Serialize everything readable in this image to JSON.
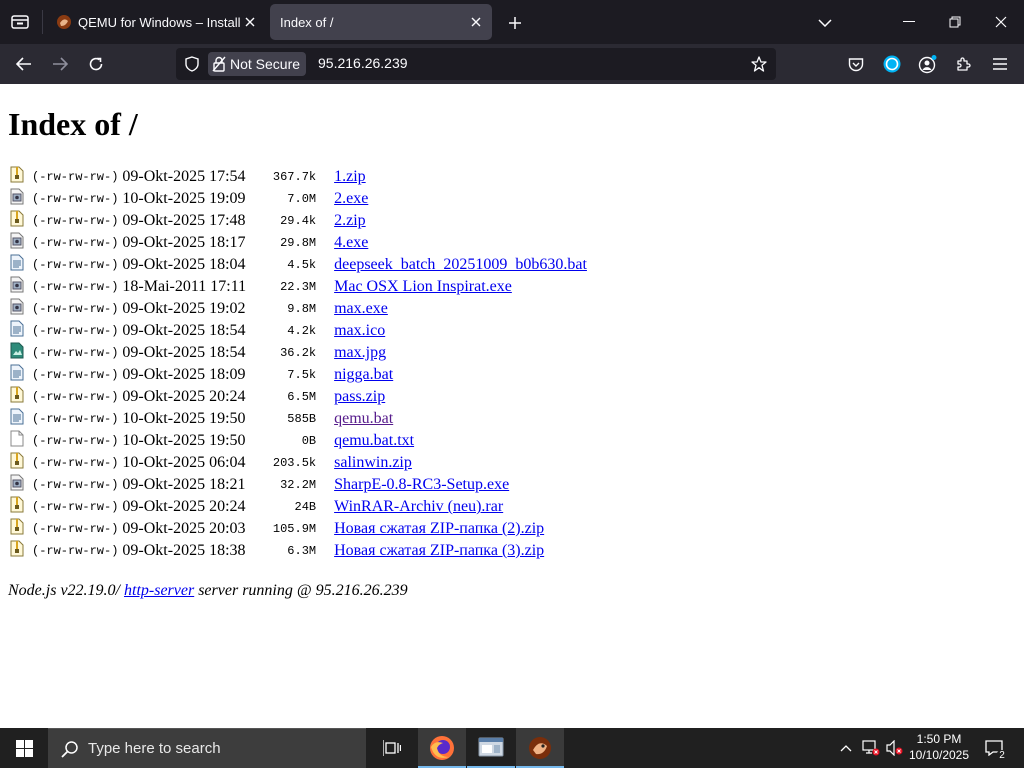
{
  "browser": {
    "tabs": [
      {
        "title": "QEMU for Windows – Installers",
        "active": false
      },
      {
        "title": "Index of /",
        "active": true
      }
    ],
    "security_label": "Not Secure",
    "url": "95.216.26.239"
  },
  "page": {
    "title": "Index of /",
    "files": [
      {
        "icon": "zip-file-icon",
        "perms": "(-rw-rw-rw-)",
        "date": "09-Okt-2025 17:54",
        "size": "367.7k",
        "name": "1.zip"
      },
      {
        "icon": "exe-file-icon",
        "perms": "(-rw-rw-rw-)",
        "date": "10-Okt-2025 19:09",
        "size": "7.0M",
        "name": "2.exe"
      },
      {
        "icon": "zip-file-icon",
        "perms": "(-rw-rw-rw-)",
        "date": "09-Okt-2025 17:48",
        "size": "29.4k",
        "name": "2.zip"
      },
      {
        "icon": "exe-file-icon",
        "perms": "(-rw-rw-rw-)",
        "date": "09-Okt-2025 18:17",
        "size": "29.8M",
        "name": "4.exe"
      },
      {
        "icon": "text-file-icon",
        "perms": "(-rw-rw-rw-)",
        "date": "09-Okt-2025 18:04",
        "size": "4.5k",
        "name": "deepseek_batch_20251009_b0b630.bat"
      },
      {
        "icon": "exe-file-icon",
        "perms": "(-rw-rw-rw-)",
        "date": "18-Mai-2011 17:11",
        "size": "22.3M",
        "name": "Mac OSX Lion Inspirat.exe"
      },
      {
        "icon": "exe-file-icon",
        "perms": "(-rw-rw-rw-)",
        "date": "09-Okt-2025 19:02",
        "size": "9.8M",
        "name": "max.exe"
      },
      {
        "icon": "text-file-icon",
        "perms": "(-rw-rw-rw-)",
        "date": "09-Okt-2025 18:54",
        "size": "4.2k",
        "name": "max.ico"
      },
      {
        "icon": "image-file-icon",
        "perms": "(-rw-rw-rw-)",
        "date": "09-Okt-2025 18:54",
        "size": "36.2k",
        "name": "max.jpg"
      },
      {
        "icon": "text-file-icon",
        "perms": "(-rw-rw-rw-)",
        "date": "09-Okt-2025 18:09",
        "size": "7.5k",
        "name": "nigga.bat"
      },
      {
        "icon": "zip-file-icon",
        "perms": "(-rw-rw-rw-)",
        "date": "09-Okt-2025 20:24",
        "size": "6.5M",
        "name": "pass.zip"
      },
      {
        "icon": "text-file-icon",
        "perms": "(-rw-rw-rw-)",
        "date": "10-Okt-2025 19:50",
        "size": "585B",
        "name": "qemu.bat",
        "visited": true
      },
      {
        "icon": "blank-file-icon",
        "perms": "(-rw-rw-rw-)",
        "date": "10-Okt-2025 19:50",
        "size": "0B",
        "name": "qemu.bat.txt"
      },
      {
        "icon": "zip-file-icon",
        "perms": "(-rw-rw-rw-)",
        "date": "10-Okt-2025 06:04",
        "size": "203.5k",
        "name": "salinwin.zip"
      },
      {
        "icon": "exe-file-icon",
        "perms": "(-rw-rw-rw-)",
        "date": "09-Okt-2025 18:21",
        "size": "32.2M",
        "name": "SharpE-0.8-RC3-Setup.exe"
      },
      {
        "icon": "zip-file-icon",
        "perms": "(-rw-rw-rw-)",
        "date": "09-Okt-2025 20:24",
        "size": "24B",
        "name": "WinRAR-Archiv (neu).rar"
      },
      {
        "icon": "zip-file-icon",
        "perms": "(-rw-rw-rw-)",
        "date": "09-Okt-2025 20:03",
        "size": "105.9M",
        "name": "Новая сжатая ZIP-папка (2).zip"
      },
      {
        "icon": "zip-file-icon",
        "perms": "(-rw-rw-rw-)",
        "date": "09-Okt-2025 18:38",
        "size": "6.3M",
        "name": "Новая сжатая ZIP-папка (3).zip"
      }
    ],
    "footer": {
      "prefix": "Node.js v22.19.0/",
      "link": "http-server",
      "suffix": "server running @ 95.216.26.239"
    }
  },
  "taskbar": {
    "search_placeholder": "Type here to search",
    "time": "1:50 PM",
    "date": "10/10/2025",
    "notification_count": "2"
  },
  "colors": {
    "link": "#0000ee",
    "visited_link": "#551a8b",
    "tabbar_bg": "#1c1b22",
    "navbar_bg": "#2b2a33",
    "taskbar_bg": "#202020"
  }
}
